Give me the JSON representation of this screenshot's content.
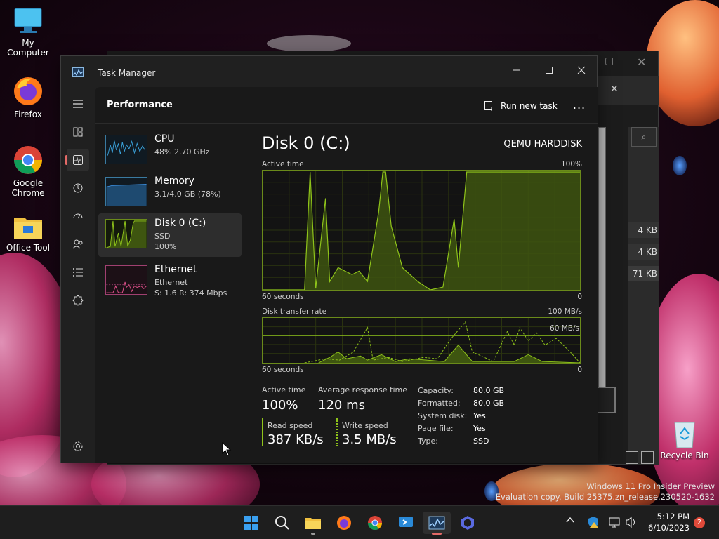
{
  "desktop": {
    "icons": [
      {
        "label": "My Computer",
        "icon": "monitor-icon"
      },
      {
        "label": "Firefox",
        "icon": "firefox-icon"
      },
      {
        "label": "Google Chrome",
        "icon": "chrome-icon"
      },
      {
        "label": "Office Tool",
        "icon": "folder-icon"
      },
      {
        "label": "Recycle Bin",
        "icon": "recycle-bin-icon"
      }
    ],
    "watermark_line1": "Windows 11 Pro Insider Preview",
    "watermark_line2": "Evaluation copy. Build 25375.zn_release.230520-1632"
  },
  "background_window": {
    "sizes": [
      "4 KB",
      "4 KB",
      "71 KB"
    ]
  },
  "task_manager": {
    "title": "Task Manager",
    "page_title": "Performance",
    "run_new_task": "Run new task",
    "more_label": "...",
    "nav_icons": [
      "hamburger-icon",
      "processes-icon",
      "performance-icon",
      "app-history-icon",
      "startup-apps-icon",
      "users-icon",
      "details-icon",
      "services-icon",
      "settings-icon"
    ],
    "resources": [
      {
        "name": "CPU",
        "line2": "48%  2.70 GHz",
        "line3": "",
        "color": "#3aa0d8"
      },
      {
        "name": "Memory",
        "line2": "3.1/4.0 GB (78%)",
        "line3": "",
        "color": "#3a8ad8"
      },
      {
        "name": "Disk 0 (C:)",
        "line2": "SSD",
        "line3": "100%",
        "color": "#8fc41a"
      },
      {
        "name": "Ethernet",
        "line2": "Ethernet",
        "line3": "S: 1.6  R: 374 Mbps",
        "color": "#e0508a"
      }
    ],
    "detail": {
      "title": "Disk 0 (C:)",
      "model": "QEMU HARDDISK",
      "graph1_label": "Active time",
      "graph1_max": "100%",
      "graph1_xleft": "60 seconds",
      "graph1_xright": "0",
      "graph2_label": "Disk transfer rate",
      "graph2_max": "100 MB/s",
      "graph2_marker": "60 MB/s",
      "graph2_xleft": "60 seconds",
      "graph2_xright": "0",
      "active_time_label": "Active time",
      "active_time_value": "100%",
      "avg_response_label": "Average response time",
      "avg_response_value": "120 ms",
      "read_speed_label": "Read speed",
      "read_speed_value": "387 KB/s",
      "write_speed_label": "Write speed",
      "write_speed_value": "3.5 MB/s",
      "props": [
        {
          "k": "Capacity:",
          "v": "80.0 GB"
        },
        {
          "k": "Formatted:",
          "v": "80.0 GB"
        },
        {
          "k": "System disk:",
          "v": "Yes"
        },
        {
          "k": "Page file:",
          "v": "Yes"
        },
        {
          "k": "Type:",
          "v": "SSD"
        }
      ]
    },
    "accent_color": "#8fc41a"
  },
  "taskbar": {
    "apps": [
      "start-icon",
      "search-icon",
      "file-explorer-icon",
      "firefox-icon",
      "chrome-icon",
      "remote-desktop-icon",
      "task-manager-icon",
      "copilot-icon"
    ],
    "time": "5:12 PM",
    "date": "6/10/2023",
    "notification_count": "2"
  }
}
